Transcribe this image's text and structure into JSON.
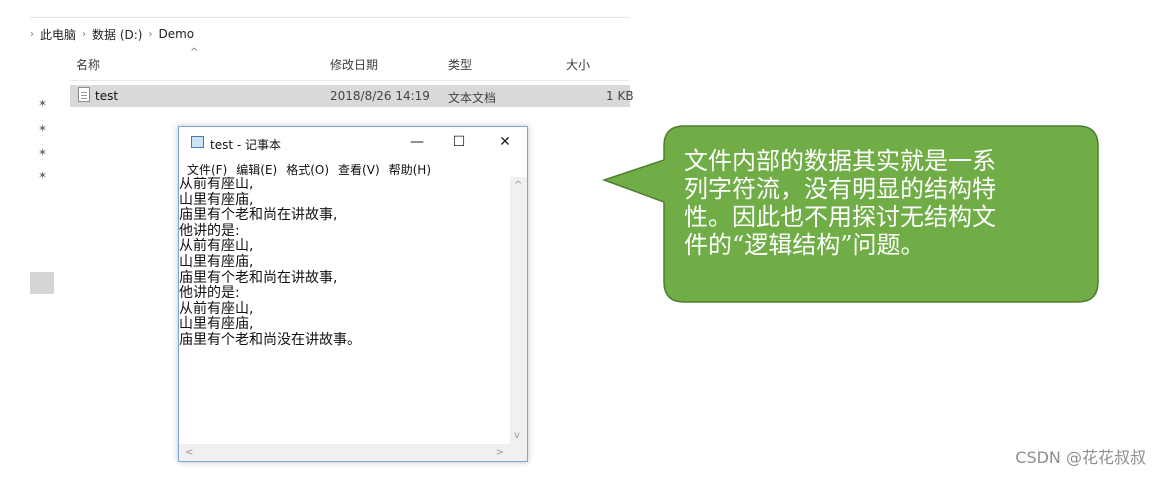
{
  "explorer": {
    "breadcrumb": [
      "此电脑",
      "数据 (D:)",
      "Demo"
    ],
    "columns": {
      "name": "名称",
      "modified": "修改日期",
      "type": "类型",
      "size": "大小"
    },
    "files": [
      {
        "name": "test",
        "modified": "2018/8/26 14:19",
        "type": "文本文档",
        "size": "1 KB"
      }
    ]
  },
  "notepad": {
    "title": "test - 记事本",
    "controls": {
      "minimize": "—",
      "maximize": "☐",
      "close": "✕"
    },
    "menu": [
      "文件(F)",
      "编辑(E)",
      "格式(O)",
      "查看(V)",
      "帮助(H)"
    ],
    "content": "从前有座山,\n山里有座庙,\n庙里有个老和尚在讲故事,\n他讲的是:\n从前有座山,\n山里有座庙,\n庙里有个老和尚在讲故事,\n他讲的是:\n从前有座山,\n山里有座庙,\n庙里有个老和尚没在讲故事。"
  },
  "callout": {
    "text": "文件内部的数据其实就是一系\n列字符流，没有明显的结构特\n性。因此也不用探讨无结构文\n件的“逻辑结构”问题。",
    "fill": "#70ad47",
    "stroke": "#507e32"
  },
  "watermark": "CSDN @花花叔叔"
}
